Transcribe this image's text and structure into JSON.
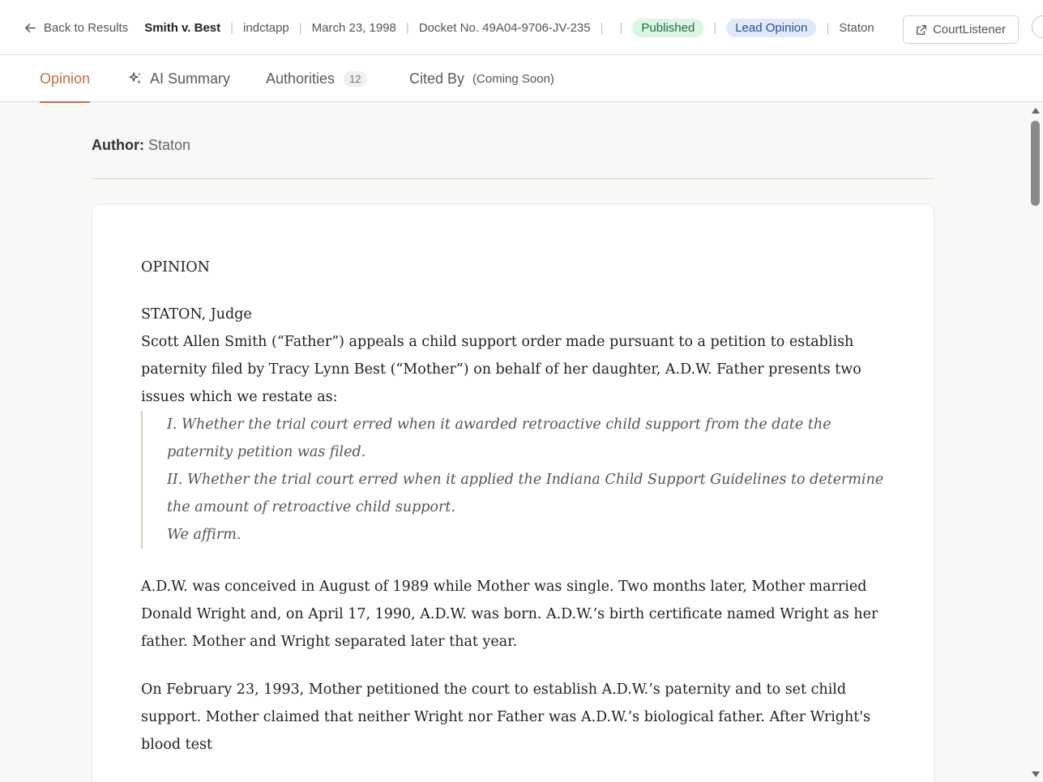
{
  "header": {
    "back_label": "Back to Results",
    "case_title": "Smith v. Best",
    "court": "indctapp",
    "date": "March 23, 1998",
    "docket": "Docket No. 49A04-9706-JV-235",
    "status_badge": "Published",
    "opinion_type_badge": "Lead Opinion",
    "author": "Staton",
    "courtlistener_label": "CourtListener"
  },
  "tabs": [
    {
      "label": "Opinion",
      "active": true
    },
    {
      "label": "AI Summary"
    },
    {
      "label": "Authorities",
      "count": "12"
    },
    {
      "label": "Cited By",
      "note": "(Coming Soon)"
    }
  ],
  "author_section": {
    "label": "Author:",
    "name": "Staton"
  },
  "opinion": {
    "heading": "OPINION",
    "judge": "STATON, Judge",
    "intro": "Scott Allen Smith (“Father”) appeals a child support order made pursuant to a petition to establish paternity filed by Tracy Lynn Best (“Mother”) on behalf of her daughter, A.D.W. Father presents two issues which we restate as:",
    "issues": [
      "I. Whether the trial court erred when it awarded retroactive child support from the date the paternity petition was filed.",
      "II. Whether the trial court erred when it applied the Indiana Child Support Guidelines to determine the amount of retroactive child support.",
      "We affirm."
    ],
    "para1": "A.D.W. was conceived in August of 1989 while Mother was single. Two months later, Mother married Donald Wright and, on April 17, 1990, A.D.W. was born. A.D.W.’s birth certificate named Wright as her father. Mother and Wright separated later that year.",
    "para2": "On February 23, 1993, Mother petitioned the court to establish A.D.W.’s paternity and to set child support. Mother claimed that neither Wright nor Father was A.D.W.’s biological father. After Wright's blood test"
  },
  "colors": {
    "accent": "#c0704f",
    "published_bg": "#dcf5e4",
    "lead_bg": "#dfe9fa"
  }
}
